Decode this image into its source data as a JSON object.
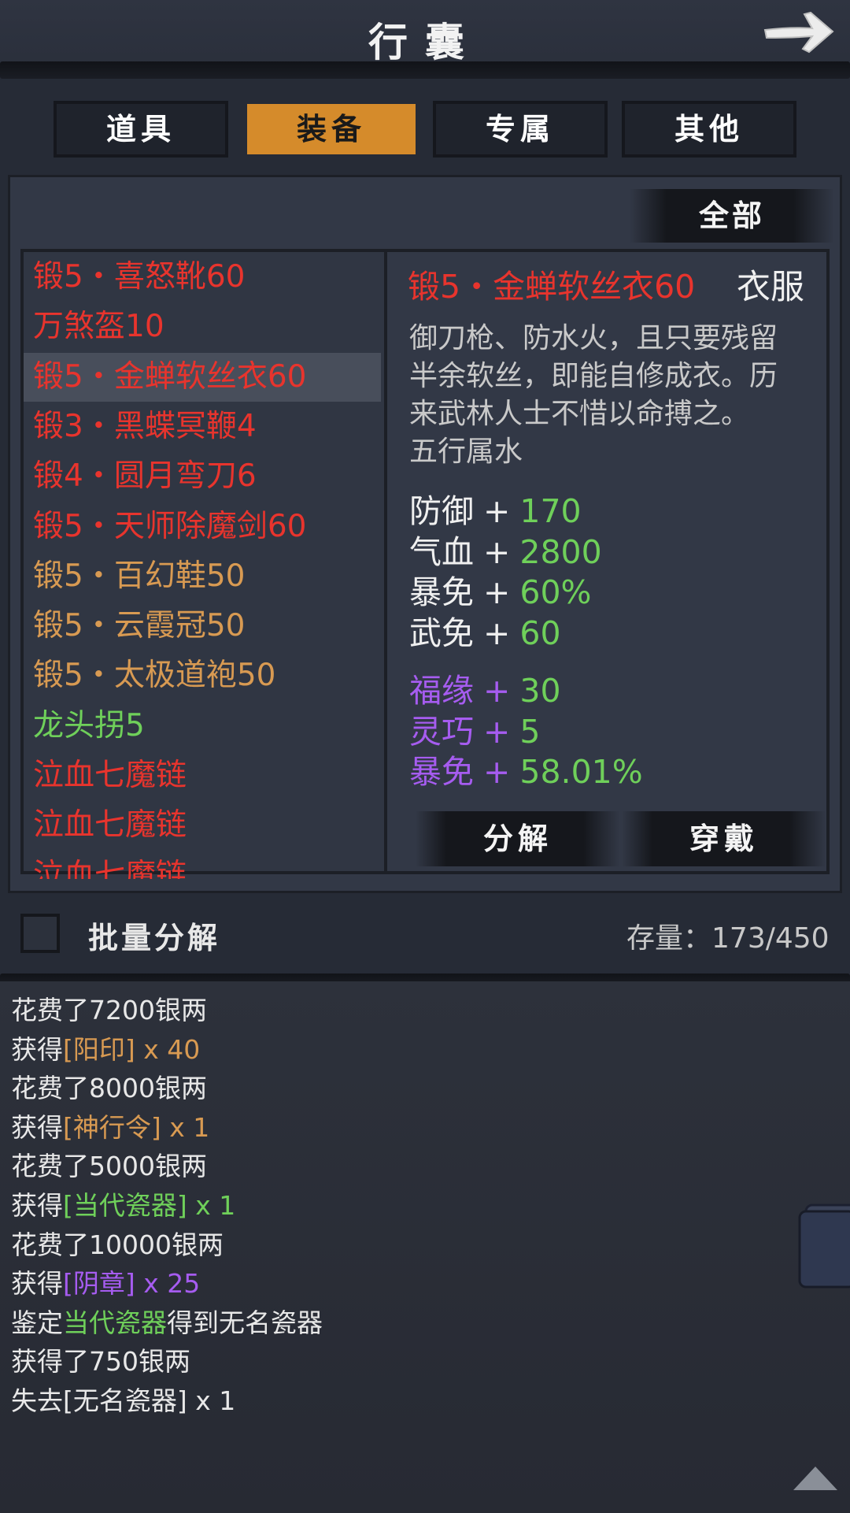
{
  "header": {
    "title": "行囊"
  },
  "tabs": [
    {
      "label": "道具",
      "active": false
    },
    {
      "label": "装备",
      "active": true
    },
    {
      "label": "专属",
      "active": false
    },
    {
      "label": "其他",
      "active": false
    }
  ],
  "filter": {
    "label": "全部"
  },
  "item_list": [
    {
      "name": "锻5・喜怒靴60",
      "color": "#e8342d"
    },
    {
      "name": "万煞盔10",
      "color": "#e8342d"
    },
    {
      "name": "锻5・金蝉软丝衣60",
      "color": "#e8342d",
      "selected": true
    },
    {
      "name": "锻3・黑蝶冥鞭4",
      "color": "#e8342d"
    },
    {
      "name": "锻4・圆月弯刀6",
      "color": "#e8342d"
    },
    {
      "name": "锻5・天师除魔剑60",
      "color": "#e8342d"
    },
    {
      "name": "锻5・百幻鞋50",
      "color": "#d89a52"
    },
    {
      "name": "锻5・云霞冠50",
      "color": "#d89a52"
    },
    {
      "name": "锻5・太极道袍50",
      "color": "#d89a52"
    },
    {
      "name": "龙头拐5",
      "color": "#6fd05a"
    },
    {
      "name": "泣血七魔链",
      "color": "#e8342d"
    },
    {
      "name": "泣血七魔链",
      "color": "#e8342d"
    },
    {
      "name": "泣血七魔链",
      "color": "#e8342d"
    }
  ],
  "detail": {
    "name": "锻5・金蝉软丝衣60",
    "type": "衣服",
    "description": [
      "御刀枪、防水火，且只要残留",
      "半余软丝，即能自修成衣。历",
      "来武林人士不惜以命搏之。",
      "五行属水"
    ],
    "stats": [
      {
        "label": "防御",
        "plus": "+",
        "value": "170"
      },
      {
        "label": "气血",
        "plus": "+",
        "value": "2800"
      },
      {
        "label": "暴免",
        "plus": "+",
        "value": "60%"
      },
      {
        "label": "武免",
        "plus": "+",
        "value": "60"
      }
    ],
    "bonus_stats": [
      {
        "label": "福缘",
        "plus": "+",
        "value": "30"
      },
      {
        "label": "灵巧",
        "plus": "+",
        "value": "5"
      },
      {
        "label": "暴免",
        "plus": "+",
        "value": "58.01%"
      }
    ],
    "decompose_label": "分解",
    "equip_label": "穿戴"
  },
  "footer": {
    "batch_decompose_label": "批量分解",
    "storage_label": "存量：",
    "storage_value": "173/450"
  },
  "log": [
    [
      {
        "t": "花费了7200银两",
        "c": "#e8e8e8"
      }
    ],
    [
      {
        "t": "获得",
        "c": "#e8e8e8"
      },
      {
        "t": "[阳印]",
        "c": "#d89a52"
      },
      {
        "t": " x 40",
        "c": "#d89a52"
      }
    ],
    [
      {
        "t": "花费了8000银两",
        "c": "#e8e8e8"
      }
    ],
    [
      {
        "t": "获得",
        "c": "#e8e8e8"
      },
      {
        "t": "[神行令]",
        "c": "#d89a52"
      },
      {
        "t": " x 1",
        "c": "#d89a52"
      }
    ],
    [
      {
        "t": "花费了5000银两",
        "c": "#e8e8e8"
      }
    ],
    [
      {
        "t": "获得",
        "c": "#e8e8e8"
      },
      {
        "t": "[当代瓷器]",
        "c": "#6fd05a"
      },
      {
        "t": " x 1",
        "c": "#6fd05a"
      }
    ],
    [
      {
        "t": "花费了10000银两",
        "c": "#e8e8e8"
      }
    ],
    [
      {
        "t": "获得",
        "c": "#e8e8e8"
      },
      {
        "t": "[阴章]",
        "c": "#a65cf0"
      },
      {
        "t": " x 25",
        "c": "#a65cf0"
      }
    ],
    [
      {
        "t": "鉴定",
        "c": "#e8e8e8"
      },
      {
        "t": "当代瓷器",
        "c": "#6fd05a"
      },
      {
        "t": "得到无名瓷器",
        "c": "#e8e8e8"
      }
    ],
    [
      {
        "t": "获得了750银两",
        "c": "#e8e8e8"
      }
    ],
    [
      {
        "t": "失去",
        "c": "#e8e8e8"
      },
      {
        "t": "[无名瓷器]",
        "c": "#e8e8e8"
      },
      {
        "t": " x 1",
        "c": "#e8e8e8"
      }
    ]
  ],
  "icons": {
    "back": "right-arrow-icon",
    "scroll_top": "up-triangle-icon"
  }
}
